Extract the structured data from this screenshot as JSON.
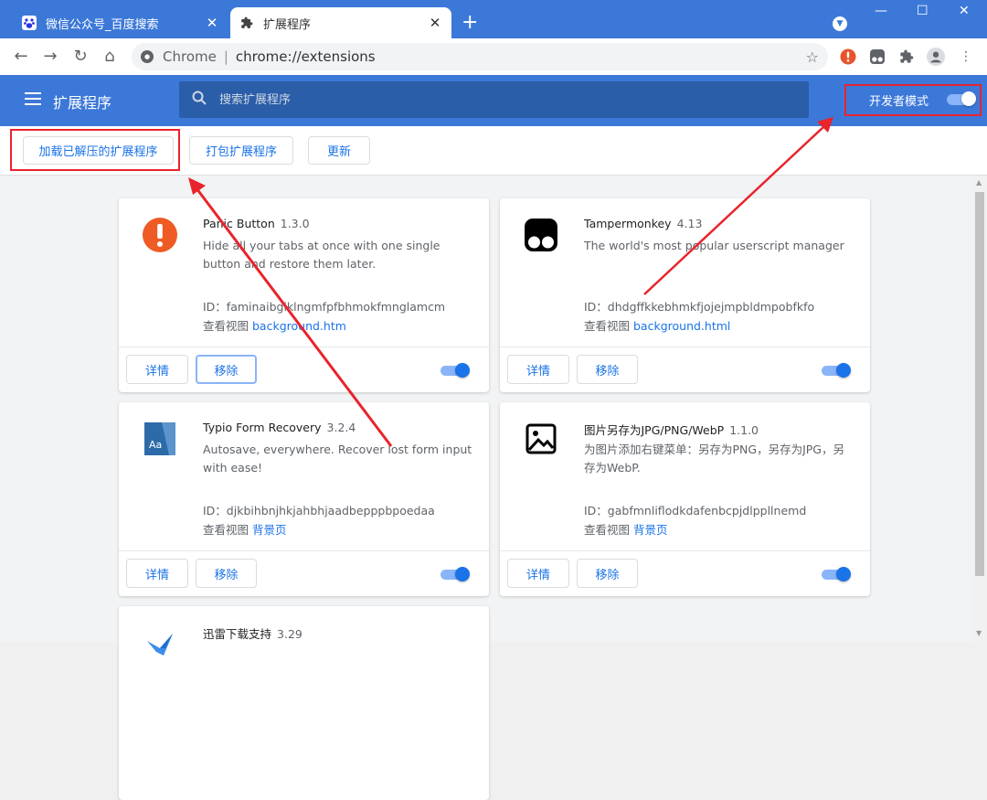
{
  "tabs": [
    {
      "title": "微信公众号_百度搜索",
      "icon": "baidu-paw-icon"
    },
    {
      "title": "扩展程序",
      "icon": "puzzle-icon"
    }
  ],
  "address": {
    "scheme": "Chrome",
    "separator": "|",
    "url": "chrome://extensions"
  },
  "header": {
    "title": "扩展程序",
    "search_placeholder": "搜索扩展程序",
    "dev_mode_label": "开发者模式",
    "dev_mode_on": true
  },
  "actions": {
    "load_unpacked": "加载已解压的扩展程序",
    "pack": "打包扩展程序",
    "update": "更新"
  },
  "buttons": {
    "details": "详情",
    "remove": "移除"
  },
  "view_label": "查看视图",
  "extensions": [
    {
      "name": "Panic Button",
      "version": "1.3.0",
      "description": "Hide all your tabs at once with one single button and restore them later.",
      "id": "ID：faminaibgiklngmfpfbhmokfmnglamcm",
      "view_link": "background.htm",
      "enabled": true,
      "icon": "panic-exclamation-icon"
    },
    {
      "name": "Tampermonkey",
      "version": "4.13",
      "description": "The world's most popular userscript manager",
      "id": "ID：dhdgffkkebhmkfjojejmpbldmpobfkfo",
      "view_link": "background.html",
      "enabled": true,
      "icon": "tampermonkey-icon"
    },
    {
      "name": "Typio Form Recovery",
      "version": "3.2.4",
      "description": "Autosave, everywhere. Recover lost form input with ease!",
      "id": "ID：djkbihbnjhkjahbhjaadbepppbpoedaa",
      "view_link": "背景页",
      "enabled": true,
      "icon": "typio-aa-icon"
    },
    {
      "name": "图片另存为JPG/PNG/WebP",
      "version": "1.1.0",
      "description": "为图片添加右键菜单：另存为PNG，另存为JPG，另存为WebP.",
      "id": "ID：gabfmnliflodkdafenbcpjdlppllnemd",
      "view_link": "背景页",
      "enabled": true,
      "icon": "image-icon"
    },
    {
      "name": "迅雷下载支持",
      "version": "3.29",
      "icon": "thunder-bird-icon"
    }
  ],
  "colors": {
    "chrome_blue": "#3c78d8",
    "link_blue": "#1a73e8",
    "highlight_red": "#e8242c"
  }
}
